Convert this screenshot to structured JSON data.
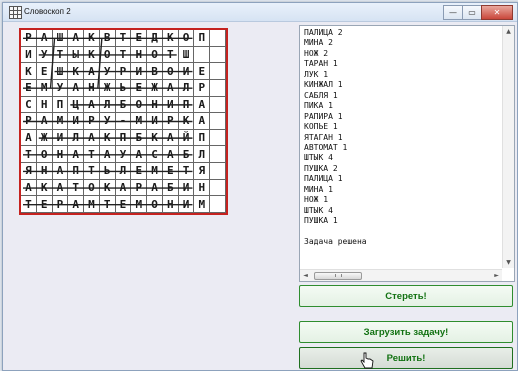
{
  "window": {
    "title": "Словоскоп 2",
    "controls": {
      "minimize": "—",
      "maximize": "▭",
      "close": "✕"
    }
  },
  "grid": {
    "rows": [
      [
        "Р",
        "А",
        "Ш",
        "А",
        "К",
        "В",
        "Т",
        "Е",
        "Д",
        "К",
        "О",
        "П",
        ""
      ],
      [
        "И",
        "У",
        "Т",
        "Ы",
        "К",
        "О",
        "Т",
        "Н",
        "О",
        "Т",
        "Ш",
        "",
        ""
      ],
      [
        "К",
        "Е",
        "Ш",
        "К",
        "А",
        "У",
        "Р",
        "И",
        "В",
        "О",
        "И",
        "Е",
        ""
      ],
      [
        "Е",
        "М",
        "У",
        "А",
        "Н",
        "Ж",
        "Ь",
        "Е",
        "Ж",
        "А",
        "Л",
        "Р",
        ""
      ],
      [
        "С",
        "Н",
        "П",
        "Ц",
        "А",
        "Л",
        "Б",
        "О",
        "Н",
        "И",
        "П",
        "А",
        ""
      ],
      [
        "Р",
        "А",
        "М",
        "И",
        "Р",
        "У",
        "-",
        "М",
        "И",
        "Р",
        "К",
        "А",
        ""
      ],
      [
        "А",
        "Ж",
        "И",
        "Л",
        "А",
        "К",
        "П",
        "Б",
        "К",
        "А",
        "Й",
        "П",
        ""
      ],
      [
        "Т",
        "О",
        "Н",
        "А",
        "Т",
        "А",
        "У",
        "А",
        "С",
        "А",
        "Б",
        "Л",
        ""
      ],
      [
        "Я",
        "Н",
        "А",
        "П",
        "Т",
        "Ь",
        "Л",
        "Е",
        "М",
        "Е",
        "Т",
        "Я",
        ""
      ],
      [
        "А",
        "К",
        "А",
        "Т",
        "О",
        "К",
        "А",
        "Р",
        "А",
        "Б",
        "И",
        "Н",
        ""
      ],
      [
        "Т",
        "Е",
        "Р",
        "А",
        "М",
        "Т",
        "Е",
        "М",
        "О",
        "Н",
        "И",
        "М",
        ""
      ]
    ]
  },
  "word_list": [
    "ПАЛИЦА 2",
    "МИНА 2",
    "НОЖ 2",
    "ТАРАН 1",
    "ЛУК 1",
    "КИНЖАЛ 1",
    "САБЛЯ 1",
    "ПИКА 1",
    "РАПИРА 1",
    "КОПЬЕ 1",
    "ЯТАГАН 1",
    "АВТОМАТ 1",
    "ШТЫК 4",
    "ПУШКА 2",
    "ПАЛИЦА 1",
    "МИНА 1",
    "НОЖ 1",
    "ШТЫК 4",
    "ПУШКА 1",
    "",
    "Задача решена"
  ],
  "buttons": {
    "clear": "Стереть!",
    "load": "Загрузить задачу!",
    "solve": "Решить!"
  },
  "scrollbar": {
    "left_arrow": "◄",
    "right_arrow": "►",
    "up_arrow": "▲",
    "down_arrow": "▼"
  },
  "colors": {
    "grid_border": "#c5221f",
    "button_text": "#127212",
    "button_border": "#2f8d2f"
  }
}
